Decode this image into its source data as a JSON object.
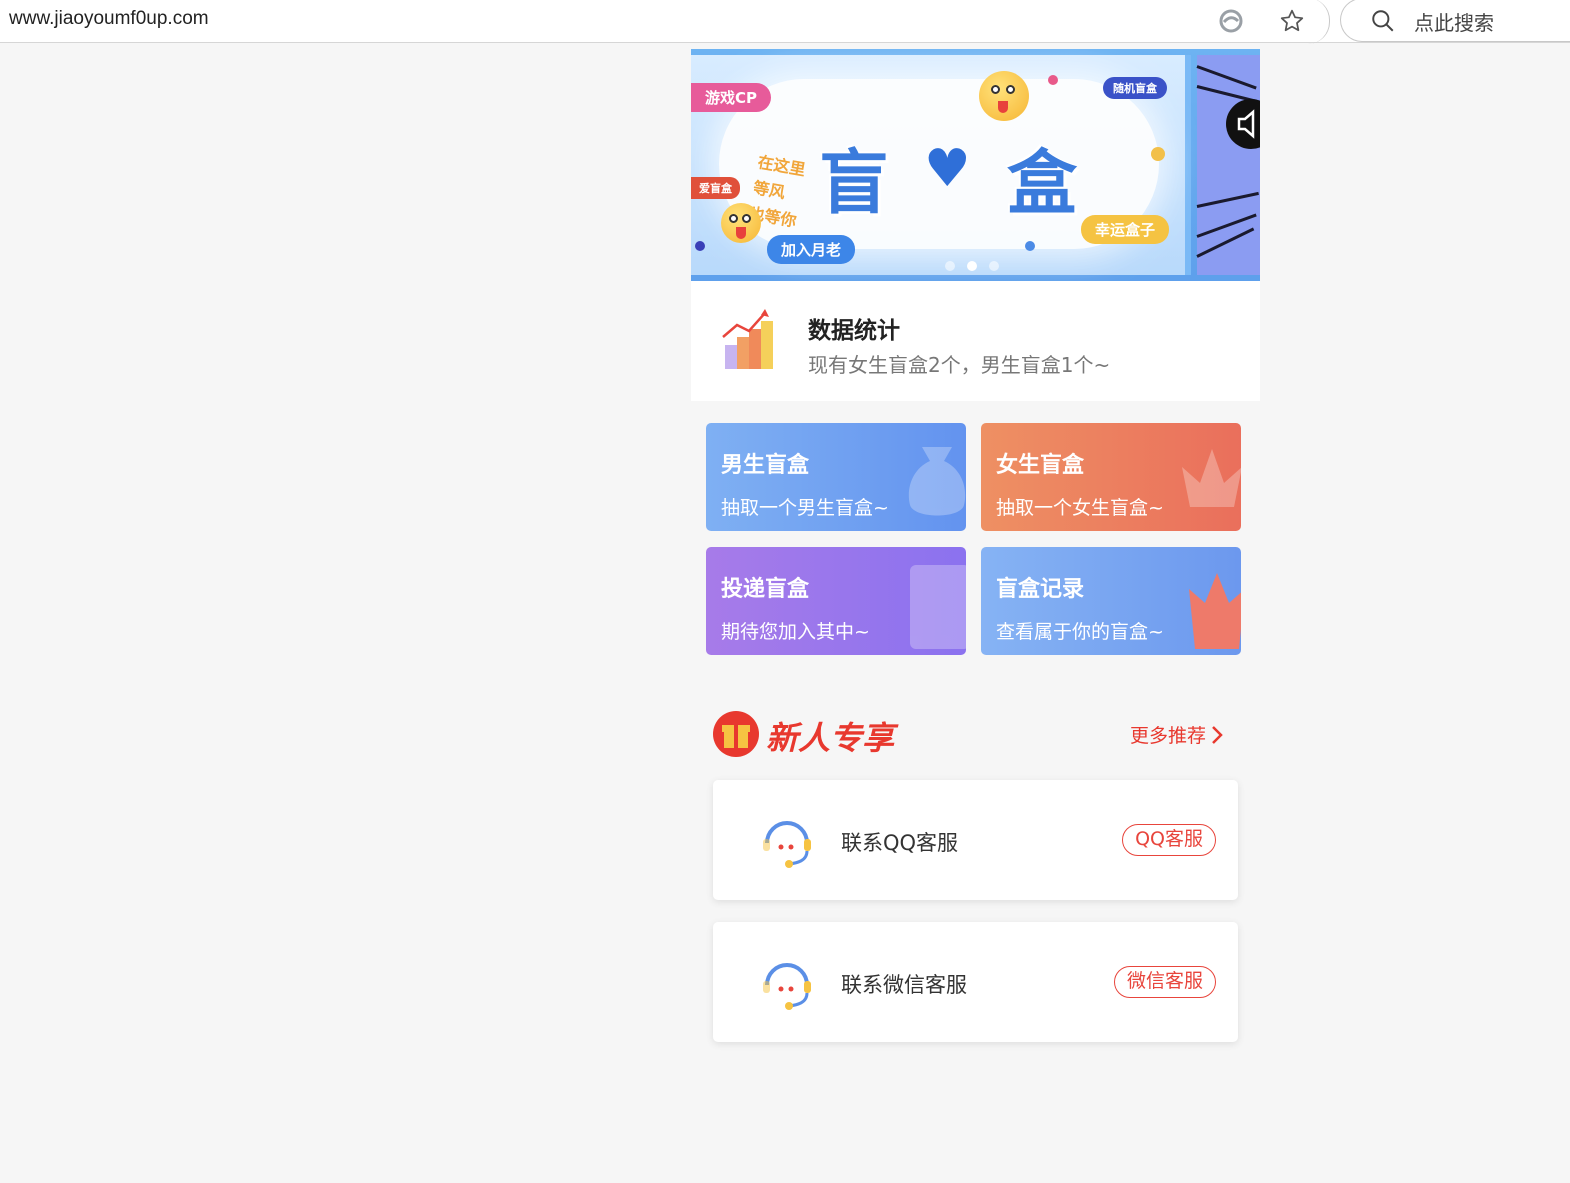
{
  "browser": {
    "url": "www.jiaoyoumf0up.com",
    "search_placeholder": "点此搜索"
  },
  "banner": {
    "title_left": "盲",
    "title_right": "盒",
    "tag_game_cp": "游戏CP",
    "tag_random": "随机盲盒",
    "tag_left_partial": "爱盲盒",
    "side_lines": [
      "在这里",
      "等风",
      "也等你"
    ],
    "tag_join": "加入月老",
    "tag_lucky": "幸运盒子",
    "slides": 3,
    "active_slide": 2
  },
  "stats": {
    "title": "数据统计",
    "subtitle": "现有女生盲盒2个，男生盲盒1个~"
  },
  "cards": [
    {
      "title": "男生盲盒",
      "subtitle": "抽取一个男生盲盒~"
    },
    {
      "title": "女生盲盒",
      "subtitle": "抽取一个女生盲盒~"
    },
    {
      "title": "投递盲盒",
      "subtitle": "期待您加入其中~"
    },
    {
      "title": "盲盒记录",
      "subtitle": "查看属于你的盲盒~"
    }
  ],
  "section": {
    "title": "新人专享",
    "more": "更多推荐"
  },
  "services": [
    {
      "label": "联系QQ客服",
      "button": "QQ客服"
    },
    {
      "label": "联系微信客服",
      "button": "微信客服"
    }
  ],
  "colors": {
    "accent_red": "#e8382e",
    "card_blue": "#6393ef",
    "card_orange": "#ea6f5c",
    "card_purple": "#8b72ef"
  }
}
